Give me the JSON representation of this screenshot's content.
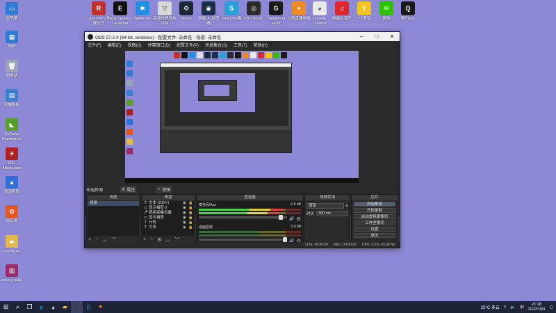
{
  "desktop": {
    "left_icons": [
      {
        "label": "此电脑",
        "icon": "computer-icon",
        "color": "#2f7bd6",
        "glyph": "▭"
      },
      {
        "label": "网络",
        "icon": "network-icon",
        "color": "#2f7bd6",
        "glyph": "▦"
      },
      {
        "label": "回收站",
        "icon": "recycle-bin-icon",
        "color": "#9aa6b8",
        "glyph": "🗑"
      },
      {
        "label": "控制面板",
        "icon": "control-panel-icon",
        "color": "#3a7fd0",
        "glyph": "▤"
      },
      {
        "label": "GeForce Experience",
        "icon": "geforce-icon",
        "color": "#5a9e2a",
        "glyph": "◣"
      },
      {
        "label": "MSI Afterburner",
        "icon": "msi-afterburner-icon",
        "color": "#b02020",
        "glyph": "✈"
      },
      {
        "label": "极速剪辑",
        "icon": "video-editor-icon",
        "color": "#2f6fd8",
        "glyph": "▲"
      },
      {
        "label": "向日葵",
        "icon": "sunflower-icon",
        "color": "#e6561f",
        "glyph": "✿"
      },
      {
        "label": "among us",
        "icon": "folder-icon",
        "color": "#e2b84a",
        "glyph": "▰"
      },
      {
        "label": "among us(1)",
        "icon": "archive-icon",
        "color": "#9b2a6a",
        "glyph": "▥"
      }
    ],
    "top_icons": [
      {
        "label": "Launcher - 快捷方式",
        "icon": "launcher-icon",
        "color": "#c0312d",
        "glyph": "R"
      },
      {
        "label": "Epic Games Launcher",
        "icon": "epic-games-icon",
        "color": "#111111",
        "glyph": "E"
      },
      {
        "label": "Battle.net",
        "icon": "battlenet-icon",
        "color": "#1e8fe3",
        "glyph": "✱"
      },
      {
        "label": "完美世界竞技平台",
        "icon": "perfect-world-icon",
        "color": "#d8d8d8",
        "glyph": "▽"
      },
      {
        "label": "Steam",
        "icon": "steam-icon",
        "color": "#1b2838",
        "glyph": "⚙"
      },
      {
        "label": "网易UU加速器",
        "icon": "uu-accelerator-icon",
        "color": "#1a2f4a",
        "glyph": "◉"
      },
      {
        "label": "Sam'USB客",
        "icon": "usb-client-icon",
        "color": "#2aa0d8",
        "glyph": "S"
      },
      {
        "label": "OBS Studio",
        "icon": "obs-icon",
        "color": "#2b2b2b",
        "glyph": "◎"
      },
      {
        "label": "Logitech G HUB",
        "icon": "logitech-icon",
        "color": "#1a1a1a",
        "glyph": "G"
      },
      {
        "label": "斗鱼直播伴侣",
        "icon": "douyu-icon",
        "color": "#f08a24",
        "glyph": "✦"
      },
      {
        "label": "Google Chrome",
        "icon": "chrome-icon",
        "color": "#e8e8e8",
        "glyph": "◕"
      },
      {
        "label": "网易云音乐",
        "icon": "netease-music-icon",
        "color": "#e0262c",
        "glyph": "♫"
      },
      {
        "label": "YY语音",
        "icon": "yy-voice-icon",
        "color": "#f2c21d",
        "glyph": "Y"
      },
      {
        "label": "微信",
        "icon": "wechat-icon",
        "color": "#2dc100",
        "glyph": "✉"
      },
      {
        "label": "腾讯QQ",
        "icon": "qq-icon",
        "color": "#1a1a1a",
        "glyph": "Q"
      }
    ]
  },
  "obs": {
    "title": "OBS 27.2.4 (64-bit, windows) - 配置文件: 未命名 - 场景: 未命名",
    "menu": [
      "文件(F)",
      "编辑(E)",
      "视图(V)",
      "停靠窗口(D)",
      "配置文件(P)",
      "场景集合(S)",
      "工具(T)",
      "帮助(H)"
    ],
    "source_bar": {
      "label": "未选择源",
      "properties": "属性",
      "filters": "滤镜"
    },
    "docks": {
      "scenes": {
        "title": "场景",
        "items": [
          "场景"
        ]
      },
      "sources": {
        "title": "来源",
        "items": [
          {
            "type": "T",
            "name": "文本 (GDI+)"
          },
          {
            "type": "▭",
            "name": "显示捕获 2"
          },
          {
            "type": "🎤",
            "name": "视频采集设备"
          },
          {
            "type": "▭",
            "name": "显示捕获"
          },
          {
            "type": "T",
            "name": "计时"
          },
          {
            "type": "T",
            "name": "文本"
          }
        ]
      },
      "mixer": {
        "title": "混音器",
        "channels": [
          {
            "name": "麦克风/Aux",
            "db": "-0.5 dB",
            "level": 0.82,
            "volume": 0.95
          },
          {
            "name": "桌面音频",
            "db": "0.0 dB",
            "level": 0.0,
            "volume": 1.0
          }
        ]
      },
      "transitions": {
        "title": "场景转场",
        "type": "渐变",
        "duration_label": "时长",
        "duration": "300 ms"
      },
      "controls": {
        "title": "控件",
        "buttons": [
          "开始推流",
          "开始录制",
          "启动虚拟摄像机",
          "工作室模式",
          "设置",
          "退出"
        ]
      }
    },
    "status": {
      "live": "LIVE: 00:00:00",
      "rec": "REC: 00:00:00",
      "cpu": "CPU: 3.2%, 60.00 fps"
    }
  },
  "taskbar": {
    "weather": "25°C 多云",
    "time": "21:28",
    "date": "2022/10/3",
    "lang": "中",
    "apps": [
      {
        "icon": "windows-start-icon",
        "color": "#ffffff",
        "glyph": "⊞"
      },
      {
        "icon": "search-icon",
        "color": "#ffffff",
        "glyph": "⌕"
      },
      {
        "icon": "task-view-icon",
        "color": "#ffffff",
        "glyph": "❐"
      },
      {
        "icon": "edge-icon",
        "color": "#2aa7d8",
        "glyph": "e"
      },
      {
        "icon": "chrome-icon",
        "color": "#e8e8e8",
        "glyph": "◕"
      },
      {
        "icon": "file-explorer-icon",
        "color": "#e2b84a",
        "glyph": "▰"
      },
      {
        "icon": "obs-icon",
        "color": "#3a3a3a",
        "glyph": "◎"
      },
      {
        "icon": "usb-client-icon",
        "color": "#2aa0d8",
        "glyph": "S"
      },
      {
        "icon": "douyu-icon",
        "color": "#f08a24",
        "glyph": "✦"
      }
    ]
  }
}
